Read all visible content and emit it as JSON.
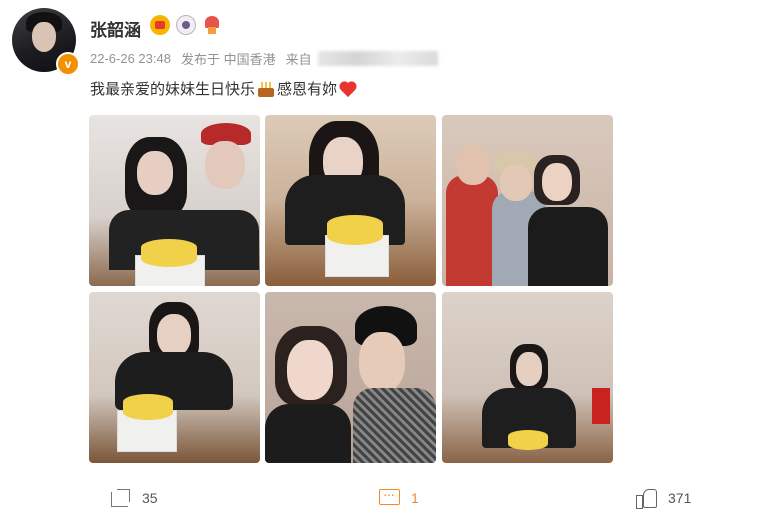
{
  "post": {
    "username": "张韶涵",
    "verified_mark": "v",
    "timestamp": "22-6-26 23:48",
    "location": "发布于 中国香港",
    "source_label": "来自",
    "text_before": "我最亲爱的妹妹生日快乐",
    "text_after": "感恩有妳"
  },
  "badges": [
    "crown-badge",
    "camera-badge",
    "tree-badge"
  ],
  "actions": {
    "share_count": "35",
    "comment_count": "1",
    "like_count": "371"
  },
  "colors": {
    "accent_orange": "#f18a2b",
    "verified": "#f29100",
    "text_main": "#333333",
    "text_meta": "#939393"
  }
}
